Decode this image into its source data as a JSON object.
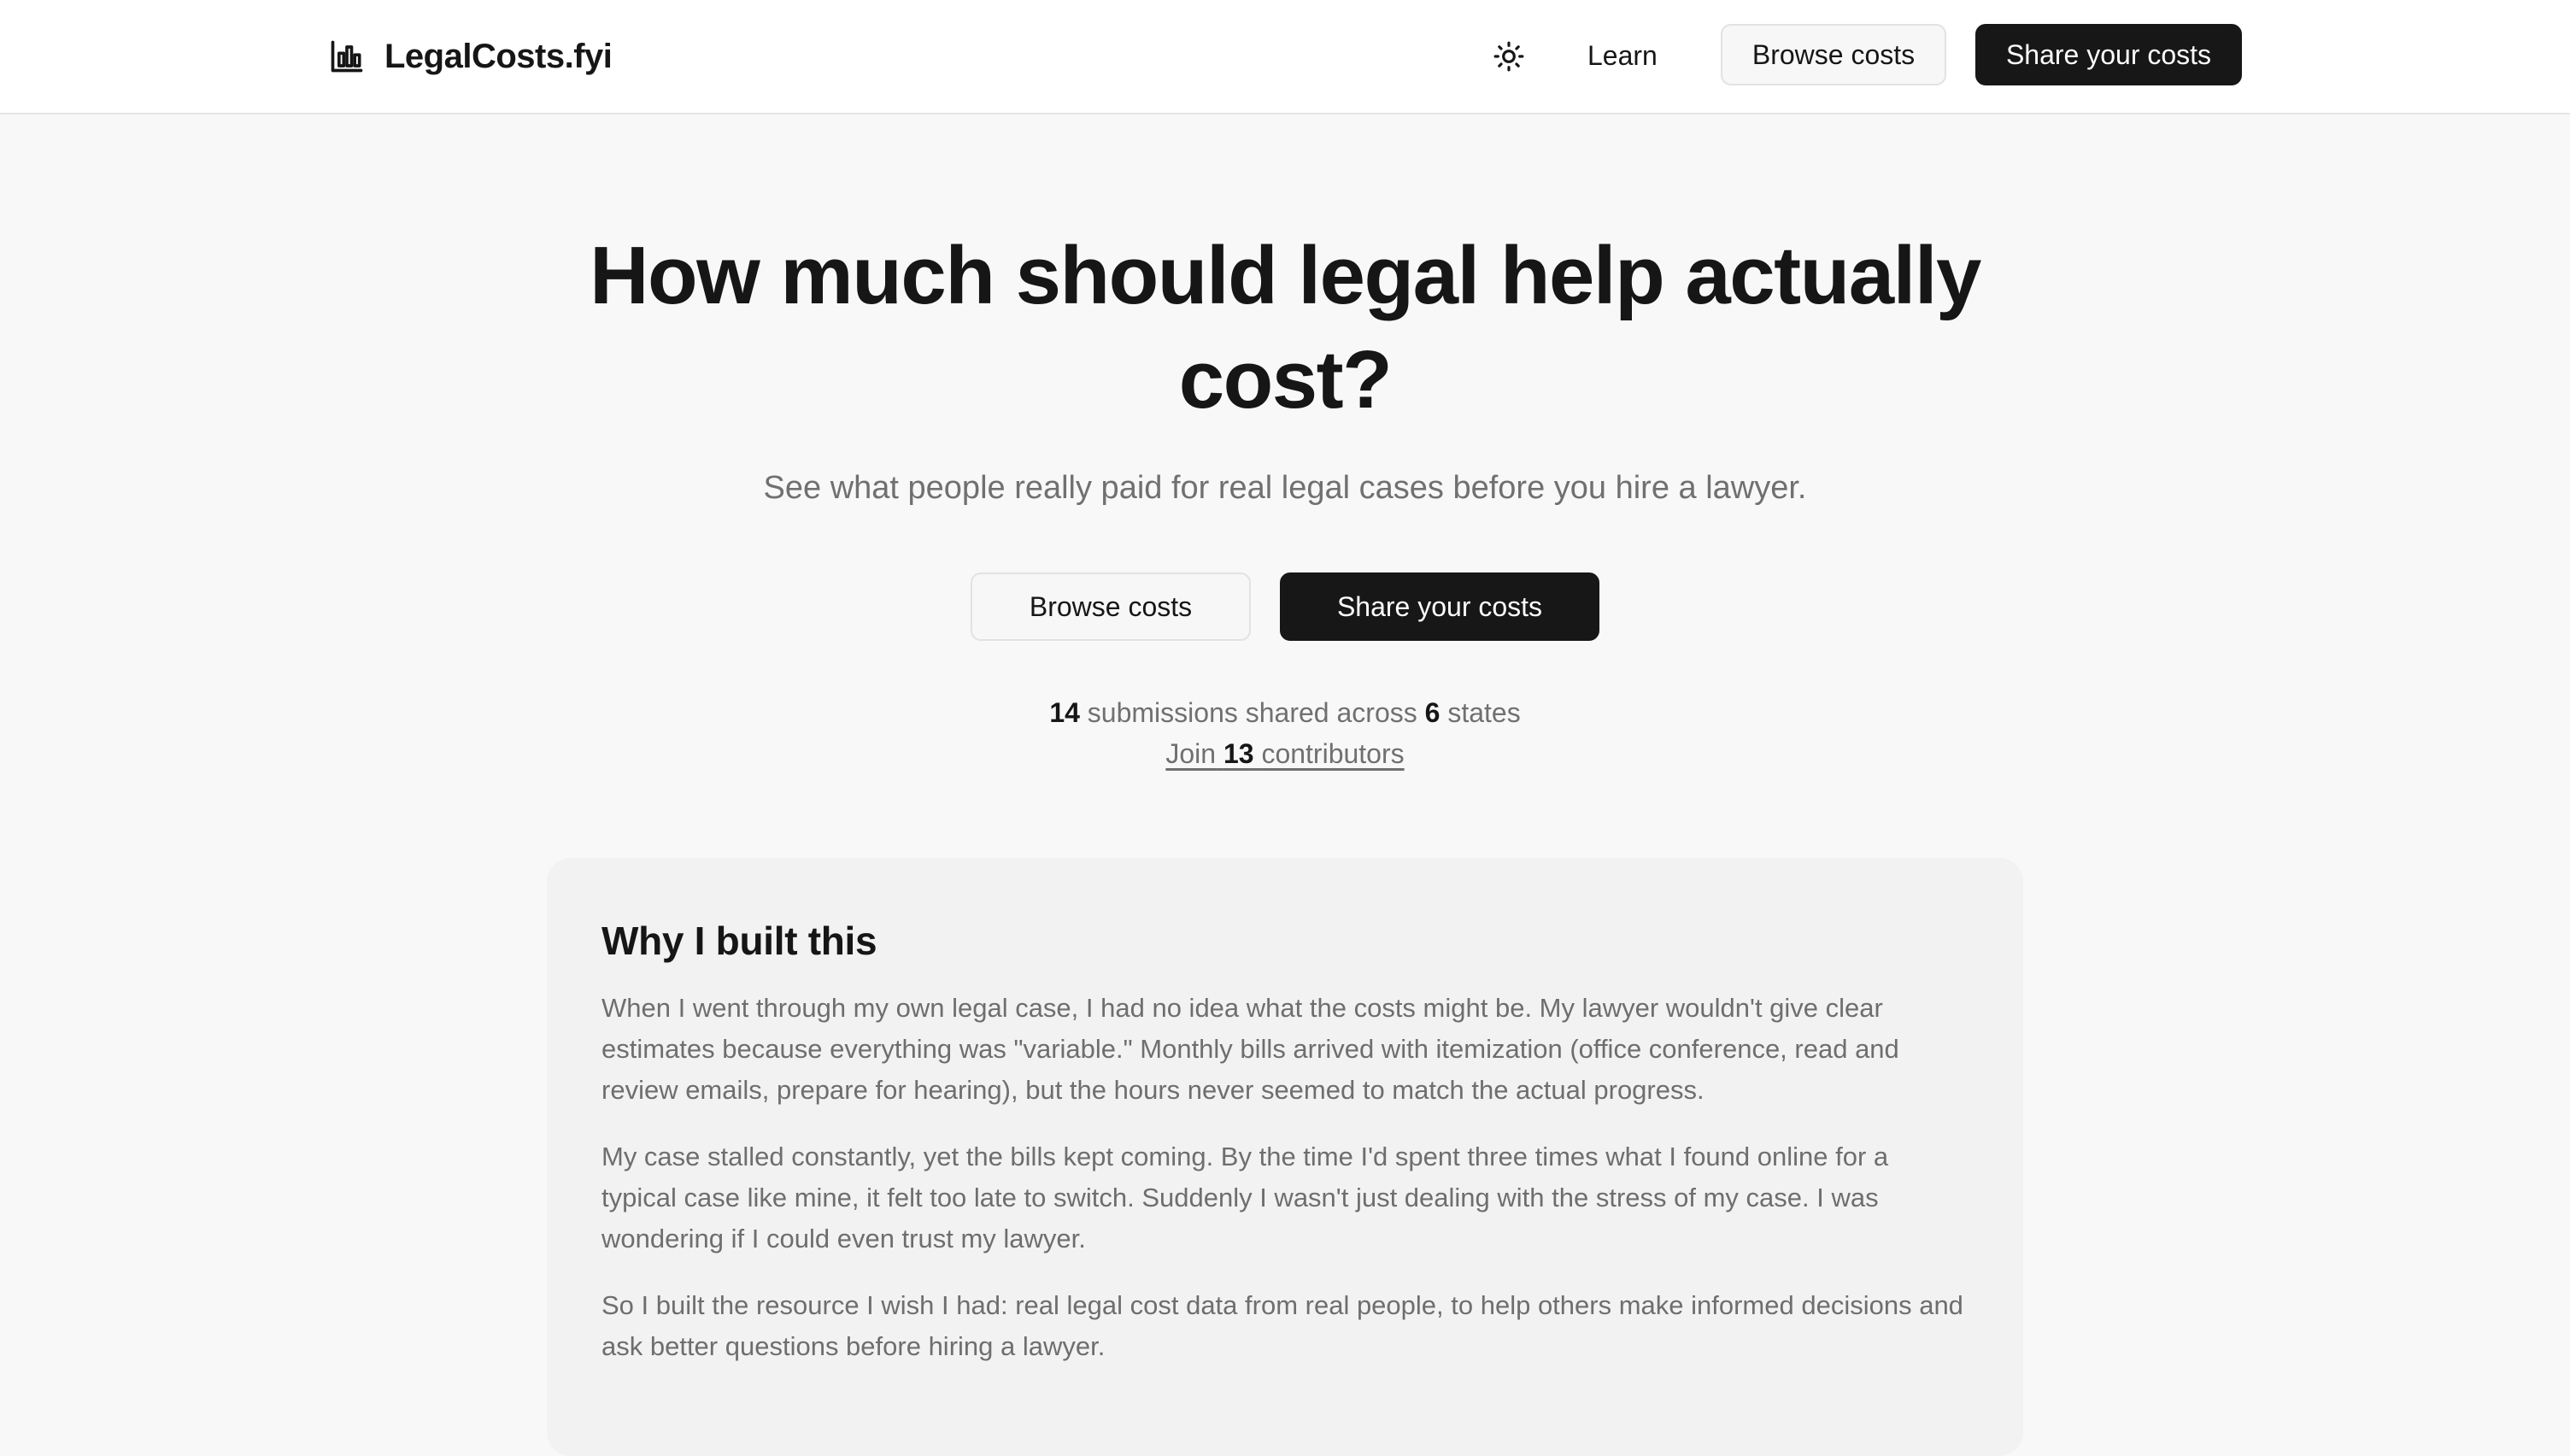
{
  "header": {
    "brand": "LegalCosts.fyi",
    "brand_icon": "bar-chart-icon",
    "theme_icon": "sun-icon",
    "nav_learn": "Learn",
    "browse_label": "Browse costs",
    "share_label": "Share your costs"
  },
  "hero": {
    "title": "How much should legal help actually cost?",
    "subtitle": "See what people really paid for real legal cases before you hire a lawyer.",
    "browse_label": "Browse costs",
    "share_label": "Share your costs"
  },
  "stats": {
    "submissions": "14",
    "submissions_text": "submissions shared across",
    "states": "6",
    "states_text": "states",
    "join_prefix": "Join",
    "contributors": "13",
    "contributors_text": "contributors"
  },
  "story": {
    "heading": "Why I built this",
    "paragraphs": [
      "When I went through my own legal case, I had no idea what the costs might be. My lawyer wouldn't give clear estimates because everything was \"variable.\" Monthly bills arrived with itemization (office conference, read and review emails, prepare for hearing), but the hours never seemed to match the actual progress.",
      "My case stalled constantly, yet the bills kept coming. By the time I'd spent three times what I found online for a typical case like mine, it felt too late to switch. Suddenly I wasn't just dealing with the stress of my case. I was wondering if I could even trust my lawyer.",
      "So I built the resource I wish I had: real legal cost data from real people, to help others make informed decisions and ask better questions before hiring a lawyer."
    ]
  },
  "colors": {
    "page_bg": "#f8f8f8",
    "header_bg": "#ffffff",
    "dark_button": "#171717",
    "muted_text": "#707070",
    "card_bg": "#f2f2f2"
  }
}
